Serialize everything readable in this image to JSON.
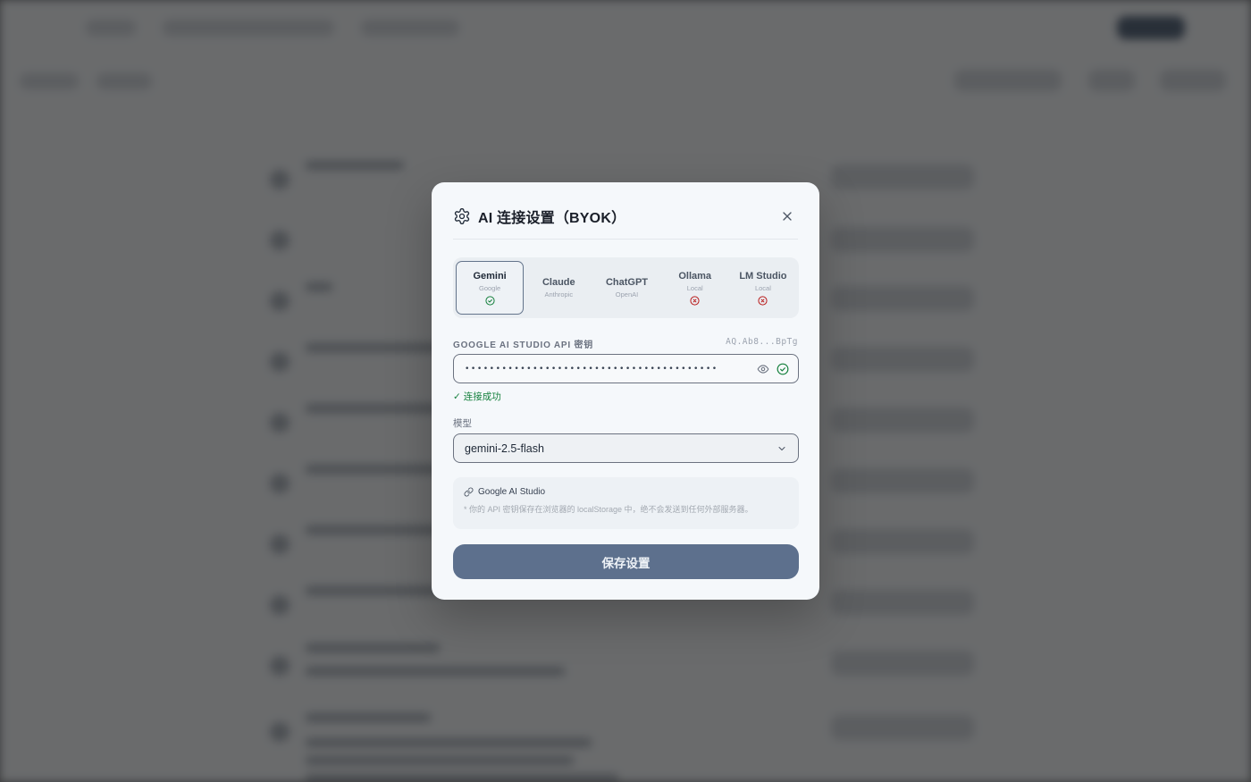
{
  "modal": {
    "title": "AI 连接设置（BYOK）",
    "providers": [
      {
        "name": "Gemini",
        "sub": "Google",
        "status": "connected",
        "active": true
      },
      {
        "name": "Claude",
        "sub": "Anthropic",
        "status": "",
        "active": false
      },
      {
        "name": "ChatGPT",
        "sub": "OpenAI",
        "status": "",
        "active": false
      },
      {
        "name": "Ollama",
        "sub": "Local",
        "status": "error",
        "active": false
      },
      {
        "name": "LM Studio",
        "sub": "Local",
        "status": "error",
        "active": false
      }
    ],
    "api_key": {
      "label": "GOOGLE AI STUDIO API 密钥",
      "hint": "AQ.Ab8...BpTg",
      "masked_value": "•••••••••••••••••••••••••••••••••••••••••",
      "status_text": "✓ 连接成功"
    },
    "model": {
      "label": "模型",
      "selected": "gemini-2.5-flash"
    },
    "info": {
      "link_text": "Google AI Studio",
      "note": "* 你的 API 密钥保存在浏览器的 localStorage 中，绝不会发送到任何外部服务器。"
    },
    "save_label": "保存设置"
  },
  "icons": {
    "settings": "gear-icon",
    "close": "close-icon",
    "connected": "check-circle-icon",
    "error": "x-circle-icon",
    "visibility": "eye-icon",
    "verified": "check-circle-icon",
    "dropdown": "chevron-down-icon",
    "link": "link-icon"
  },
  "colors": {
    "accent": "#5d708d",
    "success": "#15803d",
    "error": "#b91c1c"
  }
}
